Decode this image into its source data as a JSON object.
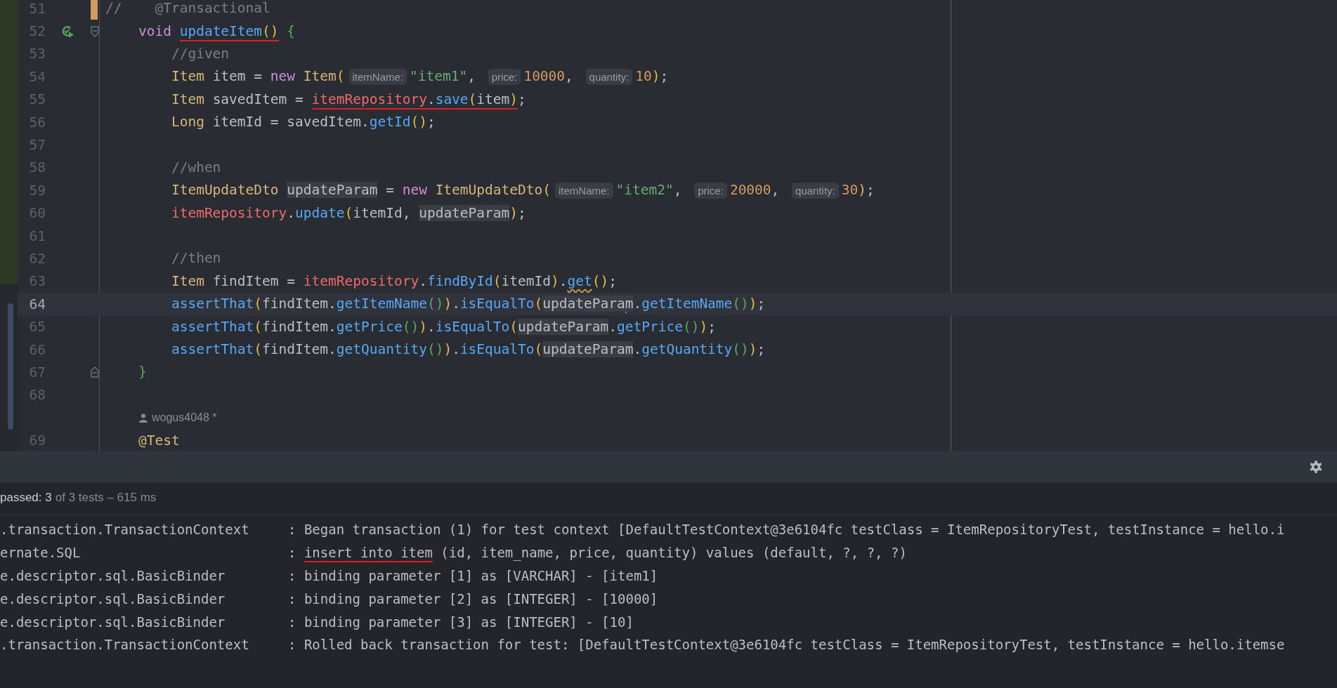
{
  "editor": {
    "lines": [
      {
        "kind": "code",
        "number": "51",
        "changed": true,
        "tokens": [
          {
            "kind": "cmt",
            "text": "//    @Transactional"
          }
        ]
      },
      {
        "kind": "code",
        "number": "52",
        "run_icon": true,
        "fold_start": true,
        "tokens": [
          {
            "kind": "kw",
            "text": "    void "
          },
          {
            "kind": "fn",
            "text": "updateItem",
            "underlined": true
          },
          {
            "kind": "p1",
            "text": "()",
            "underlined": true
          },
          {
            "kind": "p2",
            "text": " {"
          }
        ]
      },
      {
        "kind": "code",
        "number": "53",
        "tokens": [
          {
            "kind": "cmt",
            "text": "        //given"
          }
        ]
      },
      {
        "kind": "code",
        "number": "54",
        "tokens": [
          {
            "kind": "type",
            "text": "        Item"
          },
          {
            "kind": "text",
            "text": " item = "
          },
          {
            "kind": "kw",
            "text": "new "
          },
          {
            "kind": "type",
            "text": "Item"
          },
          {
            "kind": "p1",
            "text": "("
          },
          {
            "kind": "hint",
            "text": "itemName:"
          },
          {
            "kind": "str",
            "text": "\"item1\""
          },
          {
            "kind": "text",
            "text": ", "
          },
          {
            "kind": "hint",
            "text": "price:"
          },
          {
            "kind": "num",
            "text": "10000"
          },
          {
            "kind": "text",
            "text": ", "
          },
          {
            "kind": "hint",
            "text": "quantity:"
          },
          {
            "kind": "num",
            "text": "10"
          },
          {
            "kind": "p1",
            "text": ")"
          },
          {
            "kind": "text",
            "text": ";"
          }
        ]
      },
      {
        "kind": "code",
        "number": "55",
        "tokens": [
          {
            "kind": "type",
            "text": "        Item"
          },
          {
            "kind": "text",
            "text": " savedItem = "
          },
          {
            "kind": "field",
            "text": "itemRepository",
            "underlined": true
          },
          {
            "kind": "text",
            "text": ".",
            "underlined": true
          },
          {
            "kind": "fn",
            "text": "save",
            "underlined": true
          },
          {
            "kind": "p1",
            "text": "(",
            "underlined": true
          },
          {
            "kind": "text",
            "text": "item",
            "underlined": true
          },
          {
            "kind": "p1",
            "text": ")",
            "underlined": true
          },
          {
            "kind": "text",
            "text": ";"
          }
        ]
      },
      {
        "kind": "code",
        "number": "56",
        "tokens": [
          {
            "kind": "type",
            "text": "        Long"
          },
          {
            "kind": "text",
            "text": " itemId = savedItem."
          },
          {
            "kind": "fn",
            "text": "getId"
          },
          {
            "kind": "p1",
            "text": "()"
          },
          {
            "kind": "text",
            "text": ";"
          }
        ]
      },
      {
        "kind": "code",
        "number": "57"
      },
      {
        "kind": "code",
        "number": "58",
        "tokens": [
          {
            "kind": "cmt",
            "text": "        //when"
          }
        ]
      },
      {
        "kind": "code",
        "number": "59",
        "tokens": [
          {
            "kind": "type",
            "text": "        ItemUpdateDto "
          },
          {
            "kind": "usage",
            "text": "updateParam"
          },
          {
            "kind": "text",
            "text": " = "
          },
          {
            "kind": "kw",
            "text": "new "
          },
          {
            "kind": "type",
            "text": "ItemUpdateDto"
          },
          {
            "kind": "p1",
            "text": "("
          },
          {
            "kind": "hint",
            "text": "itemName:"
          },
          {
            "kind": "str",
            "text": "\"item2\""
          },
          {
            "kind": "text",
            "text": ", "
          },
          {
            "kind": "hint",
            "text": "price:"
          },
          {
            "kind": "num",
            "text": "20000"
          },
          {
            "kind": "text",
            "text": ", "
          },
          {
            "kind": "hint",
            "text": "quantity:"
          },
          {
            "kind": "num",
            "text": "30"
          },
          {
            "kind": "p1",
            "text": ")"
          },
          {
            "kind": "text",
            "text": ";"
          }
        ]
      },
      {
        "kind": "code",
        "number": "60",
        "tokens": [
          {
            "kind": "field",
            "text": "        itemRepository"
          },
          {
            "kind": "text",
            "text": "."
          },
          {
            "kind": "fn",
            "text": "update"
          },
          {
            "kind": "p1",
            "text": "("
          },
          {
            "kind": "text",
            "text": "itemId, "
          },
          {
            "kind": "usage",
            "text": "updateParam"
          },
          {
            "kind": "p1",
            "text": ")"
          },
          {
            "kind": "text",
            "text": ";"
          }
        ]
      },
      {
        "kind": "code",
        "number": "61"
      },
      {
        "kind": "code",
        "number": "62",
        "tokens": [
          {
            "kind": "cmt",
            "text": "        //then"
          }
        ]
      },
      {
        "kind": "code",
        "number": "63",
        "tokens": [
          {
            "kind": "type",
            "text": "        Item"
          },
          {
            "kind": "text",
            "text": " findItem = "
          },
          {
            "kind": "field",
            "text": "itemRepository"
          },
          {
            "kind": "text",
            "text": "."
          },
          {
            "kind": "fn",
            "text": "findById"
          },
          {
            "kind": "p1",
            "text": "("
          },
          {
            "kind": "text",
            "text": "itemId"
          },
          {
            "kind": "p1",
            "text": ")"
          },
          {
            "kind": "text",
            "text": "."
          },
          {
            "kind": "fn",
            "text": "get",
            "warning": true
          },
          {
            "kind": "p1",
            "text": "()"
          },
          {
            "kind": "text",
            "text": ";"
          }
        ]
      },
      {
        "kind": "code",
        "number": "64",
        "current": true,
        "tokens": [
          {
            "kind": "fn",
            "text": "        assertThat"
          },
          {
            "kind": "p1",
            "text": "("
          },
          {
            "kind": "text",
            "text": "findItem."
          },
          {
            "kind": "fn",
            "text": "getItemName"
          },
          {
            "kind": "p2",
            "text": "()"
          },
          {
            "kind": "p1",
            "text": ")"
          },
          {
            "kind": "text",
            "text": "."
          },
          {
            "kind": "fn",
            "text": "isEqualTo"
          },
          {
            "kind": "p1",
            "text": "("
          },
          {
            "kind": "usage",
            "text": "updatePara"
          },
          {
            "kind": "caret"
          },
          {
            "kind": "usage",
            "text": "m"
          },
          {
            "kind": "text",
            "text": "."
          },
          {
            "kind": "fn",
            "text": "getItemName"
          },
          {
            "kind": "p2",
            "text": "()"
          },
          {
            "kind": "p1",
            "text": ")"
          },
          {
            "kind": "text",
            "text": ";"
          }
        ]
      },
      {
        "kind": "code",
        "number": "65",
        "tokens": [
          {
            "kind": "fn",
            "text": "        assertThat"
          },
          {
            "kind": "p1",
            "text": "("
          },
          {
            "kind": "text",
            "text": "findItem."
          },
          {
            "kind": "fn",
            "text": "getPrice"
          },
          {
            "kind": "p2",
            "text": "()"
          },
          {
            "kind": "p1",
            "text": ")"
          },
          {
            "kind": "text",
            "text": "."
          },
          {
            "kind": "fn",
            "text": "isEqualTo"
          },
          {
            "kind": "p1",
            "text": "("
          },
          {
            "kind": "usage",
            "text": "updateParam"
          },
          {
            "kind": "text",
            "text": "."
          },
          {
            "kind": "fn",
            "text": "getPrice"
          },
          {
            "kind": "p2",
            "text": "()"
          },
          {
            "kind": "p1",
            "text": ")"
          },
          {
            "kind": "text",
            "text": ";"
          }
        ]
      },
      {
        "kind": "code",
        "number": "66",
        "tokens": [
          {
            "kind": "fn",
            "text": "        assertThat"
          },
          {
            "kind": "p1",
            "text": "("
          },
          {
            "kind": "text",
            "text": "findItem."
          },
          {
            "kind": "fn",
            "text": "getQuantity"
          },
          {
            "kind": "p2",
            "text": "()"
          },
          {
            "kind": "p1",
            "text": ")"
          },
          {
            "kind": "text",
            "text": "."
          },
          {
            "kind": "fn",
            "text": "isEqualTo"
          },
          {
            "kind": "p1",
            "text": "("
          },
          {
            "kind": "usage",
            "text": "updateParam"
          },
          {
            "kind": "text",
            "text": "."
          },
          {
            "kind": "fn",
            "text": "getQuantity"
          },
          {
            "kind": "p2",
            "text": "()"
          },
          {
            "kind": "p1",
            "text": ")"
          },
          {
            "kind": "text",
            "text": ";"
          }
        ]
      },
      {
        "kind": "code",
        "number": "67",
        "fold_end": true,
        "tokens": [
          {
            "kind": "p2",
            "text": "    }"
          }
        ]
      },
      {
        "kind": "code",
        "number": "68"
      },
      {
        "kind": "author",
        "text": "wogus4048 *"
      },
      {
        "kind": "code",
        "number": "69",
        "tokens": [
          {
            "kind": "type",
            "text": "    @Test"
          }
        ]
      }
    ]
  },
  "test_results": {
    "summary": [
      {
        "kind": "strong",
        "text": "passed: 3"
      },
      {
        "kind": "muted",
        "text": "of 3 tests – 615 ms"
      }
    ],
    "log": [
      {
        "logger": ".transaction.TransactionContext",
        "message": [
          {
            "text": ": Began transaction (1) for test context [DefaultTestContext@3e6104fc testClass = ItemRepositoryTest, testInstance = hello.i"
          }
        ]
      },
      {
        "logger": "ernate.SQL",
        "message": [
          {
            "text": ": "
          },
          {
            "text": "insert into item",
            "underlined": true
          },
          {
            "text": " (id, item_name, price, quantity) values (default, ?, ?, ?)"
          }
        ]
      },
      {
        "logger": "e.descriptor.sql.BasicBinder",
        "message": [
          {
            "text": ": binding parameter [1] as [VARCHAR] - [item1]"
          }
        ]
      },
      {
        "logger": "e.descriptor.sql.BasicBinder",
        "message": [
          {
            "text": ": binding parameter [2] as [INTEGER] - [10000]"
          }
        ]
      },
      {
        "logger": "e.descriptor.sql.BasicBinder",
        "message": [
          {
            "text": ": binding parameter [3] as [INTEGER] - [10]"
          }
        ]
      },
      {
        "logger": ".transaction.TransactionContext",
        "message": [
          {
            "text": ": Rolled back transaction for test: [DefaultTestContext@3e6104fc testClass = ItemRepositoryTest, testInstance = hello.itemse"
          }
        ]
      }
    ]
  }
}
